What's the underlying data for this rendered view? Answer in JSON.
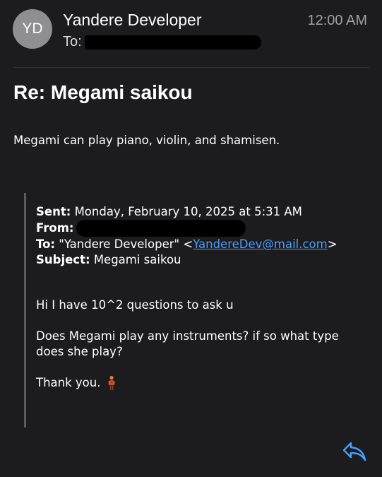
{
  "header": {
    "avatar_initials": "YD",
    "sender_name": "Yandere Developer",
    "to_label": "To:",
    "time": "12:00 AM"
  },
  "message": {
    "subject": "Re: Megami saikou",
    "body": "Megami can play piano, violin, and shamisen."
  },
  "quoted": {
    "sent_label": "Sent:",
    "sent_value": "Monday, February 10, 2025 at 5:31 AM",
    "from_label": "From:",
    "to_label": "To:",
    "to_name": "\"Yandere Developer\" <",
    "to_email": "YandereDev@mail.com",
    "to_close": ">",
    "subject_label": "Subject:",
    "subject_value": "Megami saikou",
    "line1": "Hi I have 10^2 questions to ask u",
    "line2": "Does Megami play any instruments? if so what type does she play?",
    "thanks": "Thank you."
  },
  "icons": {
    "reply": "reply-arrow-icon",
    "figure": "person-figure-icon"
  },
  "colors": {
    "background": "#1c1c1e",
    "link": "#4a9eff",
    "avatar": "#8e8e93"
  }
}
